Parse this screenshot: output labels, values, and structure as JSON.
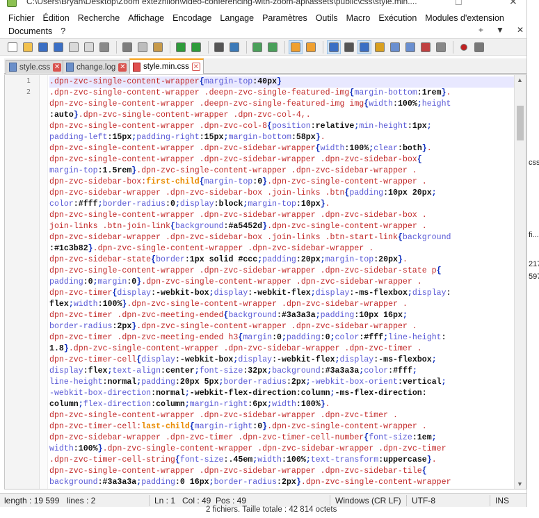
{
  "window": {
    "title": "C:\\Users\\Bryan\\Desktop\\Zoom extezniion\\video-conferencing-with-zoom-api\\assets\\public\\css\\style.min...."
  },
  "menu": {
    "row1": [
      "Fichier",
      "Édition",
      "Recherche",
      "Affichage",
      "Encodage",
      "Langage",
      "Paramètres",
      "Outils",
      "Macro",
      "Exécution",
      "Modules d'extension"
    ],
    "row2": [
      "Documents",
      "?"
    ],
    "doc_controls": [
      "+",
      "▼",
      "✕"
    ]
  },
  "tabs": [
    {
      "label": "style.css",
      "active": false
    },
    {
      "label": "change.log",
      "active": false
    },
    {
      "label": "style.min.css",
      "active": true
    }
  ],
  "line_numbers": [
    "1",
    "2"
  ],
  "status": {
    "length": "length : 19 599",
    "lines": "lines : 2",
    "ln": "Ln : 1",
    "col": "Col : 49",
    "pos": "Pos : 49",
    "eol": "Windows (CR LF)",
    "encoding": "UTF-8",
    "mode": "INS"
  },
  "background_window": {
    "footer": "2 fichiers. Taille totale : 42 814 octets",
    "fragments": [
      "css",
      "fi...",
      "217",
      "597"
    ]
  },
  "code_lines": [
    [
      [
        "sel",
        ".dpn-zvc-single-content-wrapper"
      ],
      [
        "br",
        "{"
      ],
      [
        "prop",
        "margin-top"
      ],
      [
        "val",
        ":40px"
      ],
      [
        "br",
        "}"
      ]
    ],
    [
      [
        "sel",
        ".dpn-zvc-single-content-wrapper .deepn-zvc-single-featured-img"
      ],
      [
        "br",
        "{"
      ],
      [
        "prop",
        "margin-bottom"
      ],
      [
        "val",
        ":1rem"
      ],
      [
        "br",
        "}"
      ],
      [
        "sel",
        "."
      ]
    ],
    [
      [
        "sel",
        "dpn-zvc-single-content-wrapper .deepn-zvc-single-featured-img img"
      ],
      [
        "br",
        "{"
      ],
      [
        "prop",
        "width"
      ],
      [
        "val",
        ":100%"
      ],
      [
        "br",
        ";"
      ],
      [
        "prop",
        "height"
      ]
    ],
    [
      [
        "val",
        ":auto"
      ],
      [
        "br",
        "}"
      ],
      [
        "sel",
        ".dpn-zvc-single-content-wrapper .dpn-zvc-col-4,."
      ]
    ],
    [
      [
        "sel",
        "dpn-zvc-single-content-wrapper .dpn-zvc-col-8"
      ],
      [
        "br",
        "{"
      ],
      [
        "prop",
        "position"
      ],
      [
        "val",
        ":relative"
      ],
      [
        "br",
        ";"
      ],
      [
        "prop",
        "min-height"
      ],
      [
        "val",
        ":1px"
      ],
      [
        "br",
        ";"
      ]
    ],
    [
      [
        "prop",
        "padding-left"
      ],
      [
        "val",
        ":15px"
      ],
      [
        "br",
        ";"
      ],
      [
        "prop",
        "padding-right"
      ],
      [
        "val",
        ":15px"
      ],
      [
        "br",
        ";"
      ],
      [
        "prop",
        "margin-bottom"
      ],
      [
        "val",
        ":58px"
      ],
      [
        "br",
        "}"
      ],
      [
        "sel",
        "."
      ]
    ],
    [
      [
        "sel",
        "dpn-zvc-single-content-wrapper .dpn-zvc-sidebar-wrapper"
      ],
      [
        "br",
        "{"
      ],
      [
        "prop",
        "width"
      ],
      [
        "val",
        ":100%"
      ],
      [
        "br",
        ";"
      ],
      [
        "prop",
        "clear"
      ],
      [
        "val",
        ":both"
      ],
      [
        "br",
        "}"
      ],
      [
        "sel",
        "."
      ]
    ],
    [
      [
        "sel",
        "dpn-zvc-single-content-wrapper .dpn-zvc-sidebar-wrapper .dpn-zvc-sidebar-box"
      ],
      [
        "br",
        "{"
      ]
    ],
    [
      [
        "prop",
        "margin-top"
      ],
      [
        "val",
        ":1.5rem"
      ],
      [
        "br",
        "}"
      ],
      [
        "sel",
        ".dpn-zvc-single-content-wrapper .dpn-zvc-sidebar-wrapper ."
      ]
    ],
    [
      [
        "sel",
        "dpn-zvc-sidebar-box:"
      ],
      [
        "pseudo",
        "first-child"
      ],
      [
        "br",
        "{"
      ],
      [
        "prop",
        "margin-top"
      ],
      [
        "val",
        ":0"
      ],
      [
        "br",
        "}"
      ],
      [
        "sel",
        ".dpn-zvc-single-content-wrapper ."
      ]
    ],
    [
      [
        "sel",
        "dpn-zvc-sidebar-wrapper .dpn-zvc-sidebar-box .join-links .btn"
      ],
      [
        "br",
        "{"
      ],
      [
        "prop",
        "padding"
      ],
      [
        "val",
        ":10px 20px"
      ],
      [
        "br",
        ";"
      ]
    ],
    [
      [
        "prop",
        "color"
      ],
      [
        "val",
        ":#fff"
      ],
      [
        "br",
        ";"
      ],
      [
        "prop",
        "border-radius"
      ],
      [
        "val",
        ":0"
      ],
      [
        "br",
        ";"
      ],
      [
        "prop",
        "display"
      ],
      [
        "val",
        ":block"
      ],
      [
        "br",
        ";"
      ],
      [
        "prop",
        "margin-top"
      ],
      [
        "val",
        ":10px"
      ],
      [
        "br",
        "}"
      ],
      [
        "sel",
        "."
      ]
    ],
    [
      [
        "sel",
        "dpn-zvc-single-content-wrapper .dpn-zvc-sidebar-wrapper .dpn-zvc-sidebar-box ."
      ]
    ],
    [
      [
        "sel",
        "join-links .btn-join-link"
      ],
      [
        "br",
        "{"
      ],
      [
        "prop",
        "background"
      ],
      [
        "val",
        ":#a5452d"
      ],
      [
        "br",
        "}"
      ],
      [
        "sel",
        ".dpn-zvc-single-content-wrapper ."
      ]
    ],
    [
      [
        "sel",
        "dpn-zvc-sidebar-wrapper .dpn-zvc-sidebar-box .join-links .btn-start-link"
      ],
      [
        "br",
        "{"
      ],
      [
        "prop",
        "background"
      ]
    ],
    [
      [
        "val",
        ":#1c3b82"
      ],
      [
        "br",
        "}"
      ],
      [
        "sel",
        ".dpn-zvc-single-content-wrapper .dpn-zvc-sidebar-wrapper ."
      ]
    ],
    [
      [
        "sel",
        "dpn-zvc-sidebar-state"
      ],
      [
        "br",
        "{"
      ],
      [
        "prop",
        "border"
      ],
      [
        "val",
        ":1px solid #ccc"
      ],
      [
        "br",
        ";"
      ],
      [
        "prop",
        "padding"
      ],
      [
        "val",
        ":20px"
      ],
      [
        "br",
        ";"
      ],
      [
        "prop",
        "margin-top"
      ],
      [
        "val",
        ":20px"
      ],
      [
        "br",
        "}"
      ],
      [
        "sel",
        "."
      ]
    ],
    [
      [
        "sel",
        "dpn-zvc-single-content-wrapper .dpn-zvc-sidebar-wrapper .dpn-zvc-sidebar-state p"
      ],
      [
        "br",
        "{"
      ]
    ],
    [
      [
        "prop",
        "padding"
      ],
      [
        "val",
        ":0"
      ],
      [
        "br",
        ";"
      ],
      [
        "prop",
        "margin"
      ],
      [
        "val",
        ":0"
      ],
      [
        "br",
        "}"
      ],
      [
        "sel",
        ".dpn-zvc-single-content-wrapper .dpn-zvc-sidebar-wrapper ."
      ]
    ],
    [
      [
        "sel",
        "dpn-zvc-timer"
      ],
      [
        "br",
        "{"
      ],
      [
        "prop",
        "display"
      ],
      [
        "val",
        ":-webkit-box"
      ],
      [
        "br",
        ";"
      ],
      [
        "prop",
        "display"
      ],
      [
        "val",
        ":-webkit-flex"
      ],
      [
        "br",
        ";"
      ],
      [
        "prop",
        "display"
      ],
      [
        "val",
        ":-ms-flexbox"
      ],
      [
        "br",
        ";"
      ],
      [
        "prop",
        "display"
      ],
      [
        "val",
        ":"
      ]
    ],
    [
      [
        "val",
        "flex"
      ],
      [
        "br",
        ";"
      ],
      [
        "prop",
        "width"
      ],
      [
        "val",
        ":100%"
      ],
      [
        "br",
        "}"
      ],
      [
        "sel",
        ".dpn-zvc-single-content-wrapper .dpn-zvc-sidebar-wrapper ."
      ]
    ],
    [
      [
        "sel",
        "dpn-zvc-timer .dpn-zvc-meeting-ended"
      ],
      [
        "br",
        "{"
      ],
      [
        "prop",
        "background"
      ],
      [
        "val",
        ":#3a3a3a"
      ],
      [
        "br",
        ";"
      ],
      [
        "prop",
        "padding"
      ],
      [
        "val",
        ":10px 16px"
      ],
      [
        "br",
        ";"
      ]
    ],
    [
      [
        "prop",
        "border-radius"
      ],
      [
        "val",
        ":2px"
      ],
      [
        "br",
        "}"
      ],
      [
        "sel",
        ".dpn-zvc-single-content-wrapper .dpn-zvc-sidebar-wrapper ."
      ]
    ],
    [
      [
        "sel",
        "dpn-zvc-timer .dpn-zvc-meeting-ended h3"
      ],
      [
        "br",
        "{"
      ],
      [
        "prop",
        "margin"
      ],
      [
        "val",
        ":0"
      ],
      [
        "br",
        ";"
      ],
      [
        "prop",
        "padding"
      ],
      [
        "val",
        ":0"
      ],
      [
        "br",
        ";"
      ],
      [
        "prop",
        "color"
      ],
      [
        "val",
        ":#fff"
      ],
      [
        "br",
        ";"
      ],
      [
        "prop",
        "line-height"
      ],
      [
        "val",
        ":"
      ]
    ],
    [
      [
        "val",
        "1.8"
      ],
      [
        "br",
        "}"
      ],
      [
        "sel",
        ".dpn-zvc-single-content-wrapper .dpn-zvc-sidebar-wrapper .dpn-zvc-timer ."
      ]
    ],
    [
      [
        "sel",
        "dpn-zvc-timer-cell"
      ],
      [
        "br",
        "{"
      ],
      [
        "prop",
        "display"
      ],
      [
        "val",
        ":-webkit-box"
      ],
      [
        "br",
        ";"
      ],
      [
        "prop",
        "display"
      ],
      [
        "val",
        ":-webkit-flex"
      ],
      [
        "br",
        ";"
      ],
      [
        "prop",
        "display"
      ],
      [
        "val",
        ":-ms-flexbox"
      ],
      [
        "br",
        ";"
      ]
    ],
    [
      [
        "prop",
        "display"
      ],
      [
        "val",
        ":flex"
      ],
      [
        "br",
        ";"
      ],
      [
        "prop",
        "text-align"
      ],
      [
        "val",
        ":center"
      ],
      [
        "br",
        ";"
      ],
      [
        "prop",
        "font-size"
      ],
      [
        "val",
        ":32px"
      ],
      [
        "br",
        ";"
      ],
      [
        "prop",
        "background"
      ],
      [
        "val",
        ":#3a3a3a"
      ],
      [
        "br",
        ";"
      ],
      [
        "prop",
        "color"
      ],
      [
        "val",
        ":#fff"
      ],
      [
        "br",
        ";"
      ]
    ],
    [
      [
        "prop",
        "line-height"
      ],
      [
        "val",
        ":normal"
      ],
      [
        "br",
        ";"
      ],
      [
        "prop",
        "padding"
      ],
      [
        "val",
        ":20px 5px"
      ],
      [
        "br",
        ";"
      ],
      [
        "prop",
        "border-radius"
      ],
      [
        "val",
        ":2px"
      ],
      [
        "br",
        ";"
      ],
      [
        "prop",
        "-webkit-box-orient"
      ],
      [
        "val",
        ":vertical"
      ],
      [
        "br",
        ";"
      ]
    ],
    [
      [
        "prop",
        "-webkit-box-direction"
      ],
      [
        "val",
        ":normal"
      ],
      [
        "br",
        ";"
      ],
      [
        "val",
        "-webkit-flex-direction:column"
      ],
      [
        "br",
        ";"
      ],
      [
        "val",
        "-ms-flex-direction:"
      ]
    ],
    [
      [
        "val",
        "column"
      ],
      [
        "br",
        ";"
      ],
      [
        "prop",
        "flex-direction"
      ],
      [
        "val",
        ":column"
      ],
      [
        "br",
        ";"
      ],
      [
        "prop",
        "margin-right"
      ],
      [
        "val",
        ":6px"
      ],
      [
        "br",
        ";"
      ],
      [
        "prop",
        "width"
      ],
      [
        "val",
        ":100%"
      ],
      [
        "br",
        "}"
      ],
      [
        "sel",
        "."
      ]
    ],
    [
      [
        "sel",
        "dpn-zvc-single-content-wrapper .dpn-zvc-sidebar-wrapper .dpn-zvc-timer ."
      ]
    ],
    [
      [
        "sel",
        "dpn-zvc-timer-cell:"
      ],
      [
        "pseudo",
        "last-child"
      ],
      [
        "br",
        "{"
      ],
      [
        "prop",
        "margin-right"
      ],
      [
        "val",
        ":0"
      ],
      [
        "br",
        "}"
      ],
      [
        "sel",
        ".dpn-zvc-single-content-wrapper ."
      ]
    ],
    [
      [
        "sel",
        "dpn-zvc-sidebar-wrapper .dpn-zvc-timer .dpn-zvc-timer-cell-number"
      ],
      [
        "br",
        "{"
      ],
      [
        "prop",
        "font-size"
      ],
      [
        "val",
        ":1em"
      ],
      [
        "br",
        ";"
      ]
    ],
    [
      [
        "prop",
        "width"
      ],
      [
        "val",
        ":100%"
      ],
      [
        "br",
        "}"
      ],
      [
        "sel",
        ".dpn-zvc-single-content-wrapper .dpn-zvc-sidebar-wrapper .dpn-zvc-timer"
      ]
    ],
    [
      [
        "sel",
        ".dpn-zvc-timer-cell-string"
      ],
      [
        "br",
        "{"
      ],
      [
        "prop",
        "font-size"
      ],
      [
        "val",
        ":.45em"
      ],
      [
        "br",
        ";"
      ],
      [
        "prop",
        "width"
      ],
      [
        "val",
        ":100%"
      ],
      [
        "br",
        ";"
      ],
      [
        "prop",
        "text-transform"
      ],
      [
        "val",
        ":uppercase"
      ],
      [
        "br",
        "}"
      ],
      [
        "sel",
        "."
      ]
    ],
    [
      [
        "sel",
        "dpn-zvc-single-content-wrapper .dpn-zvc-sidebar-wrapper .dpn-zvc-sidebar-tile"
      ],
      [
        "br",
        "{"
      ]
    ],
    [
      [
        "prop",
        "background"
      ],
      [
        "val",
        ":#3a3a3a"
      ],
      [
        "br",
        ";"
      ],
      [
        "prop",
        "padding"
      ],
      [
        "val",
        ":0 16px"
      ],
      [
        "br",
        ";"
      ],
      [
        "prop",
        "border-radius"
      ],
      [
        "val",
        ":2px"
      ],
      [
        "br",
        "}"
      ],
      [
        "sel",
        ".dpn-zvc-single-content-wrapper"
      ]
    ]
  ],
  "toolbar_icons": [
    "new-file-icon",
    "open-file-icon",
    "save-icon",
    "save-all-icon",
    "close-icon",
    "close-all-icon",
    "print-icon",
    "sep",
    "cut-icon",
    "copy-icon",
    "paste-icon",
    "sep",
    "undo-icon",
    "redo-icon",
    "sep",
    "find-icon",
    "replace-icon",
    "sep",
    "zoom-in-icon",
    "zoom-out-icon",
    "sep",
    "sync-vertical-icon",
    "sync-horizontal-icon",
    "sep",
    "word-wrap-icon",
    "show-all-chars-icon",
    "indent-guide-icon",
    "udl-icon",
    "doc-map-icon",
    "function-list-icon",
    "folder-workspace-icon",
    "monitor-icon",
    "sep",
    "record-macro-icon",
    "stop-record-icon"
  ]
}
